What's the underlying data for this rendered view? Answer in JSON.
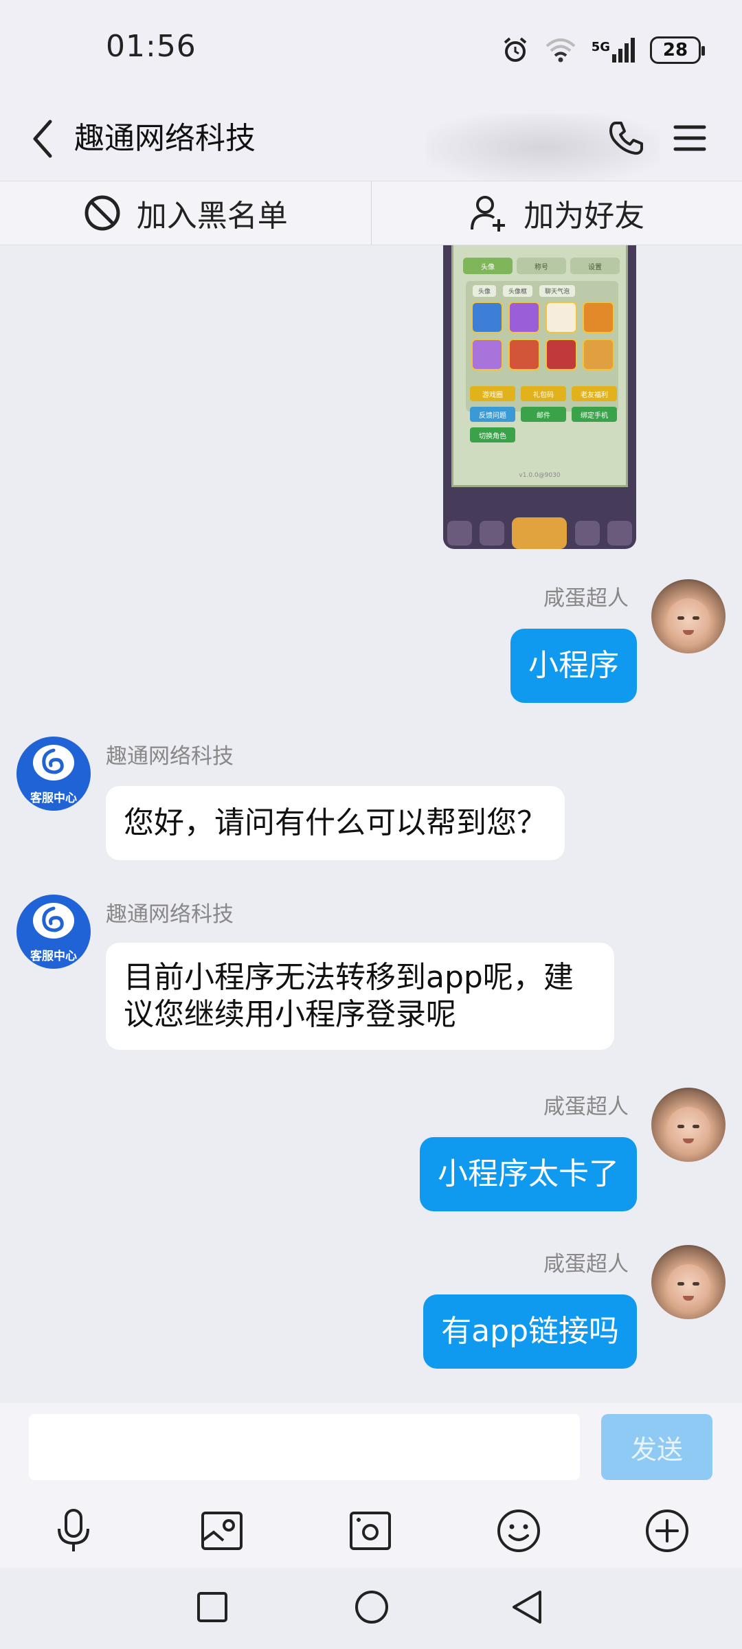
{
  "status_bar": {
    "time": "01:56",
    "network": "5G",
    "battery": "28",
    "icons": [
      "alarm-icon",
      "wifi-icon",
      "signal-icon",
      "battery-icon"
    ]
  },
  "header": {
    "title": "趣通网络科技",
    "icons": [
      "back-icon",
      "phone-icon",
      "menu-icon"
    ]
  },
  "actions": {
    "block_label": "加入黑名单",
    "add_friend_label": "加为好友"
  },
  "shared_screenshot": {
    "tabs": [
      "头像",
      "称号",
      "设置"
    ],
    "subtabs": [
      "头像",
      "头像框",
      "聊天气泡"
    ],
    "buttons": [
      "游戏圈",
      "礼包码",
      "老友福利",
      "反馈问题",
      "邮件",
      "绑定手机",
      "切换角色"
    ],
    "version": "v1.0.0@9030"
  },
  "messages": [
    {
      "side": "out",
      "sender": "咸蛋超人",
      "text": "小程序"
    },
    {
      "side": "in",
      "sender": "趣通网络科技",
      "text": "您好，请问有什么可以帮到您？"
    },
    {
      "side": "in",
      "sender": "趣通网络科技",
      "text": "目前小程序无法转移到app呢，建议您继续用小程序登录呢"
    },
    {
      "side": "out",
      "sender": "咸蛋超人",
      "text": "小程序太卡了"
    },
    {
      "side": "out",
      "sender": "咸蛋超人",
      "text": "有app链接吗"
    }
  ],
  "cs_avatar_label": "客服中心",
  "composer": {
    "input_value": "",
    "send_label": "发送",
    "tools": [
      "microphone-icon",
      "image-icon",
      "camera-icon",
      "emoji-icon",
      "plus-icon"
    ]
  },
  "colors": {
    "accent": "#0f9af0",
    "send_disabled": "#8fcaf4",
    "background": "#ececf3",
    "cs_avatar": "#1f63d6"
  }
}
